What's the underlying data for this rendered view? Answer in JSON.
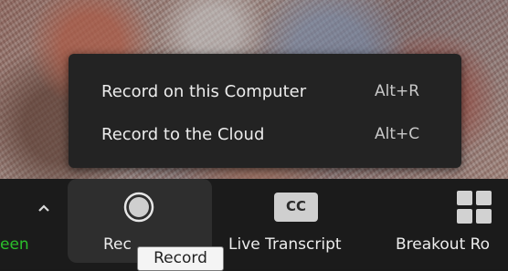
{
  "menu": {
    "items": [
      {
        "label": "Record on this Computer",
        "shortcut": "Alt+R"
      },
      {
        "label": "Record to the Cloud",
        "shortcut": "Alt+C"
      }
    ]
  },
  "toolbar": {
    "share_label": "een",
    "record_label": "Rec",
    "cc_icon_text": "CC",
    "live_transcript_label": "Live Transcript",
    "breakout_label": "Breakout Ro"
  },
  "tooltip": {
    "text": "Record"
  },
  "colors": {
    "menu_bg": "#232323",
    "toolbar_bg": "#1b1b1b",
    "share_green": "#2bbf2b",
    "active_button_bg": "#2e2e2e"
  },
  "icons": [
    "chevron-up-icon",
    "record-circle-icon",
    "closed-caption-icon",
    "breakout-rooms-grid-icon"
  ]
}
